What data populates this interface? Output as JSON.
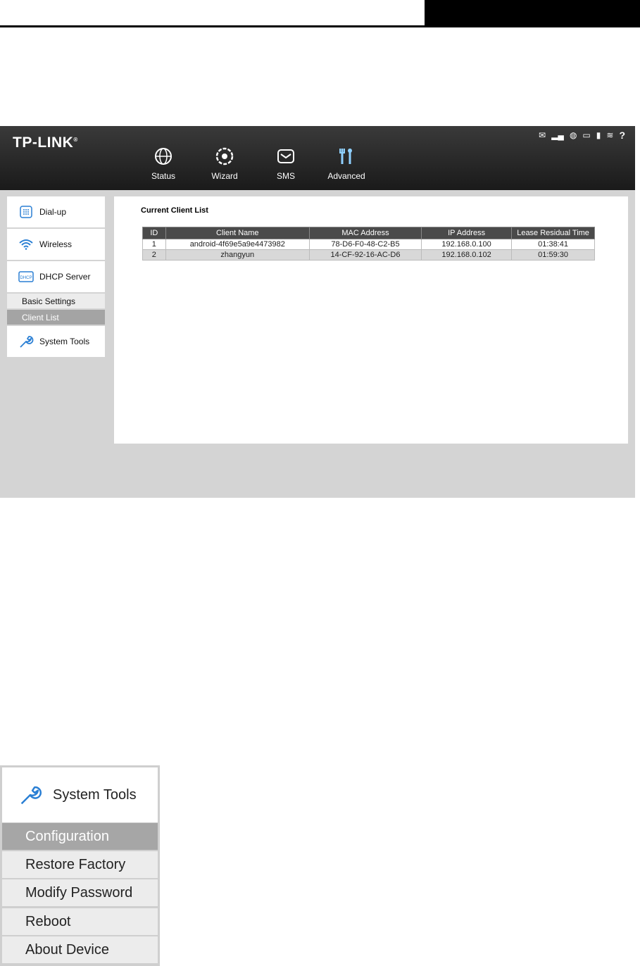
{
  "ui": {
    "logo": "TP-LINK",
    "nav": [
      {
        "label": "Status",
        "icon": "globe-icon"
      },
      {
        "label": "Wizard",
        "icon": "gear-icon"
      },
      {
        "label": "SMS",
        "icon": "envelope-icon"
      },
      {
        "label": "Advanced",
        "icon": "tools-icon"
      }
    ],
    "status_icons": [
      "envelope-icon",
      "signal-icon",
      "internet-globe-icon",
      "battery-icon",
      "sd-card-icon",
      "wifi-icon",
      "help-icon"
    ],
    "sidebar": {
      "dialup": "Dial-up",
      "wireless": "Wireless",
      "dhcp": "DHCP Server",
      "dhcp_icon_text": "DHCP",
      "basic_settings": "Basic Settings",
      "client_list": "Client List",
      "system_tools": "System Tools"
    },
    "content": {
      "title": "Current Client List",
      "columns": [
        "ID",
        "Client Name",
        "MAC Address",
        "IP Address",
        "Lease Residual Time"
      ],
      "rows": [
        [
          "1",
          "android-4f69e5a9e4473982",
          "78-D6-F0-48-C2-B5",
          "192.168.0.100",
          "01:38:41"
        ],
        [
          "2",
          "zhangyun",
          "14-CF-92-16-AC-D6",
          "192.168.0.102",
          "01:59:30"
        ]
      ]
    }
  },
  "zoom": {
    "title": "System Tools",
    "items": [
      "Configuration",
      "Restore Factory",
      "Modify Password",
      "Reboot",
      "About Device"
    ],
    "active_item": "Configuration"
  }
}
